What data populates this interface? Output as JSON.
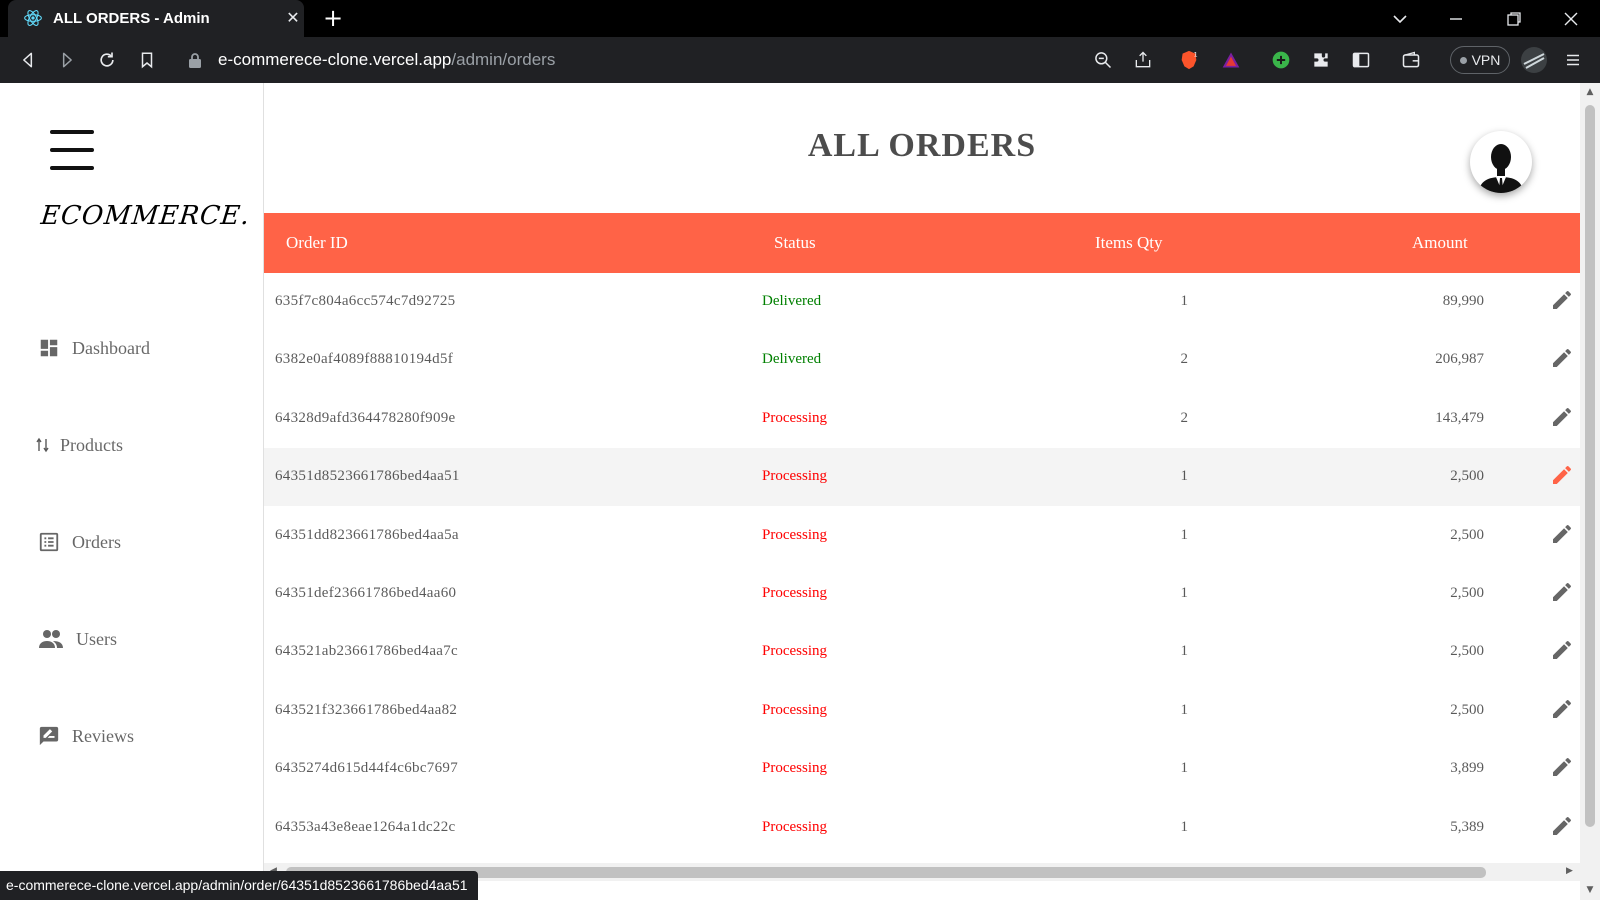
{
  "browser": {
    "tab_title": "ALL ORDERS - Admin",
    "close_glyph": "✕",
    "newtab_glyph": "+",
    "url_host": "e-commerece-clone.vercel.app",
    "url_path": "/admin/orders",
    "vpn_label": "VPN",
    "status_url": "e-commerece-clone.vercel.app/admin/order/64351d8523661786bed4aa51",
    "brave_badge": "1",
    "accent_colors": {
      "brave": "#fb542b",
      "extension_green": "#3ab54a"
    }
  },
  "sidebar": {
    "logo": "ECOMMERCE.",
    "items": [
      {
        "label": "Dashboard",
        "icon": "dashboard-icon"
      },
      {
        "label": "Products",
        "icon": "sort-arrows-icon"
      },
      {
        "label": "Orders",
        "icon": "list-alt-icon"
      },
      {
        "label": "Users",
        "icon": "people-icon"
      },
      {
        "label": "Reviews",
        "icon": "rate-review-icon"
      }
    ]
  },
  "main": {
    "title": "ALL ORDERS",
    "accent": "#ff6347",
    "columns": [
      "Order ID",
      "Status",
      "Items Qty",
      "Amount"
    ],
    "rows": [
      {
        "id": "635f7c804a6cc574c7d92725",
        "status": "Delivered",
        "qty": "1",
        "amount": "89,990"
      },
      {
        "id": "6382e0af4089f88810194d5f",
        "status": "Delivered",
        "qty": "2",
        "amount": "206,987"
      },
      {
        "id": "64328d9afd364478280f909e",
        "status": "Processing",
        "qty": "2",
        "amount": "143,479"
      },
      {
        "id": "64351d8523661786bed4aa51",
        "status": "Processing",
        "qty": "1",
        "amount": "2,500"
      },
      {
        "id": "64351dd823661786bed4aa5a",
        "status": "Processing",
        "qty": "1",
        "amount": "2,500"
      },
      {
        "id": "64351def23661786bed4aa60",
        "status": "Processing",
        "qty": "1",
        "amount": "2,500"
      },
      {
        "id": "643521ab23661786bed4aa7c",
        "status": "Processing",
        "qty": "1",
        "amount": "2,500"
      },
      {
        "id": "643521f323661786bed4aa82",
        "status": "Processing",
        "qty": "1",
        "amount": "2,500"
      },
      {
        "id": "6435274d615d44f4c6bc7697",
        "status": "Processing",
        "qty": "1",
        "amount": "3,899"
      },
      {
        "id": "64353a43e8eae1264a1dc22c",
        "status": "Processing",
        "qty": "1",
        "amount": "5,389"
      }
    ],
    "hovered_row": 3,
    "status_colors": {
      "Delivered": "#008000",
      "Processing": "#ff0000"
    }
  }
}
